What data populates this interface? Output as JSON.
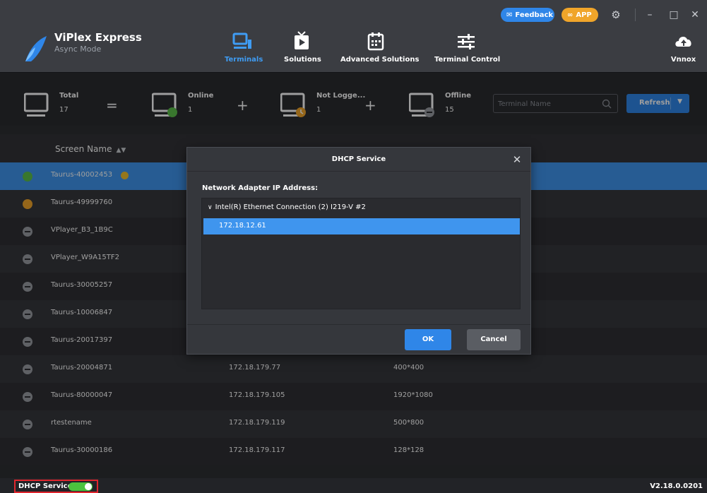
{
  "app": {
    "name": "ViPlex Express",
    "mode": "Async Mode"
  },
  "topbar": {
    "feedback_label": "Feedback",
    "app_label": "APP"
  },
  "nav": {
    "terminals": "Terminals",
    "solutions": "Solutions",
    "advanced_solutions": "Advanced Solutions",
    "terminal_control": "Terminal Control",
    "vnnox": "Vnnox"
  },
  "stats": {
    "total_label": "Total",
    "total_value": "17",
    "equals": "=",
    "online_label": "Online",
    "online_value": "1",
    "plus": "+",
    "notlogged_label": "Not Logge...",
    "notlogged_value": "1",
    "offline_label": "Offline",
    "offline_value": "15"
  },
  "search": {
    "placeholder": "Terminal Name"
  },
  "refresh_label": "Refresh",
  "table": {
    "headers": {
      "name": "Screen Name"
    },
    "rows": [
      {
        "status": "online",
        "name": "Taurus-40002453",
        "ip": "",
        "size": ""
      },
      {
        "status": "notlogged",
        "name": "Taurus-49999760",
        "ip": "",
        "size": ""
      },
      {
        "status": "offline",
        "name": "VPlayer_B3_1B9C",
        "ip": "",
        "size": ""
      },
      {
        "status": "offline",
        "name": "VPlayer_W9A15TF2",
        "ip": "",
        "size": ""
      },
      {
        "status": "offline",
        "name": "Taurus-30005257",
        "ip": "",
        "size": ""
      },
      {
        "status": "offline",
        "name": "Taurus-10006847",
        "ip": "",
        "size": ""
      },
      {
        "status": "offline",
        "name": "Taurus-20017397",
        "ip": "",
        "size": ""
      },
      {
        "status": "offline",
        "name": "Taurus-20004871",
        "ip": "172.18.179.77",
        "size": "400*400"
      },
      {
        "status": "offline",
        "name": "Taurus-80000047",
        "ip": "172.18.179.105",
        "size": "1920*1080"
      },
      {
        "status": "offline",
        "name": "rtestename",
        "ip": "172.18.179.119",
        "size": "500*800"
      },
      {
        "status": "offline",
        "name": "Taurus-30000186",
        "ip": "172.18.179.117",
        "size": "128*128"
      }
    ]
  },
  "bottom": {
    "dhcp_label": "DHCP Service",
    "dhcp_enabled": true,
    "version": "V2.18.0.0201"
  },
  "modal": {
    "title": "DHCP Service",
    "field_label": "Network Adapter IP Address:",
    "adapter": "Intel(R) Ethernet Connection (2) I219-V #2",
    "adapter_ip": "172.18.12.61",
    "ok_label": "OK",
    "cancel_label": "Cancel"
  },
  "colors": {
    "accent": "#2f86e8",
    "selected_row": "#3f95ee",
    "online": "#5cc04b",
    "notlogged": "#f0a52a",
    "offline": "#9a9da3",
    "highlight_border": "#e0262e"
  }
}
